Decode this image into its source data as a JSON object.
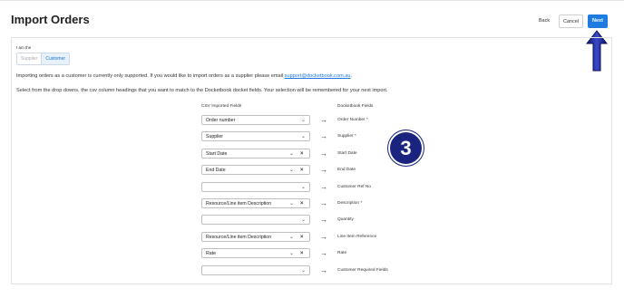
{
  "page": {
    "title": "Import Orders"
  },
  "header": {
    "back_label": "Back",
    "cancel_label": "Cancel",
    "next_label": "Next"
  },
  "role": {
    "label": "I am the",
    "options": [
      "Supplier",
      "Customer"
    ],
    "selected": "Customer"
  },
  "notice": {
    "text": "Importing orders as a customer is currently only supported. If you would like to import orders as a supplier please email ",
    "email": "support@docketbook.com.au",
    "end": "."
  },
  "instructions": "Select from the drop downs, the csv column headings that you want to match to the Docketbook docket fields. Your selection will be remembered for your next import.",
  "columns": {
    "csv": "CSV Imported Fields",
    "docketbook": "Docketbook Fields"
  },
  "mappings": [
    {
      "csv": "Order number",
      "field": "Order Number *",
      "clearable": false
    },
    {
      "csv": "Supplier",
      "field": "Supplier *",
      "clearable": false
    },
    {
      "csv": "Start Date",
      "field": "Start Date",
      "clearable": true
    },
    {
      "csv": "End Date",
      "field": "End Date",
      "clearable": true
    },
    {
      "csv": "",
      "field": "Customer Ref No",
      "clearable": false
    },
    {
      "csv": "Resource/Line item Description",
      "field": "Description *",
      "clearable": true
    },
    {
      "csv": "",
      "field": "Quantity",
      "clearable": false
    },
    {
      "csv": "Resource/Line item Description",
      "field": "Line Item Reference",
      "clearable": true
    },
    {
      "csv": "Rate",
      "field": "Rate",
      "clearable": true
    },
    {
      "csv": "",
      "field": "Customer Required Fields",
      "clearable": false
    }
  ],
  "annotation": {
    "step": "3"
  },
  "icons": {
    "arrow": "arrow-right-icon",
    "chevron": "chevron-down-icon",
    "clear": "clear-icon",
    "pointer": "arrow-up-icon"
  },
  "colors": {
    "primary": "#1e7be0",
    "badge": "#1a237e"
  }
}
